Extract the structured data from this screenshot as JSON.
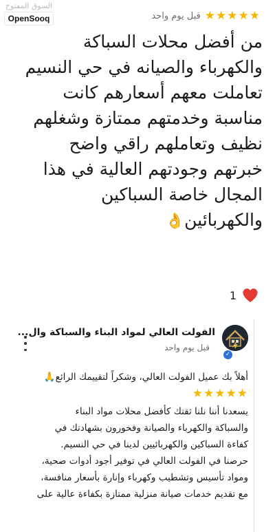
{
  "watermark": {
    "arabic": "السوق المفتوح",
    "brand": "OpenSooq"
  },
  "review": {
    "stars": 5,
    "time": "قبل يوم واحد",
    "lines": [
      "من أفضل محلات السباكة",
      "والكهرباء والصيانه في حي النسيم",
      "تعاملت معهم أسعارهم كانت",
      "مناسبة وخدمتهم ممتازة وشغلهم",
      "نظيف وتعاملهم راقي  واضح",
      "خبرتهم وجودتهم العالية في هذا",
      "المجال خاصة السباكين",
      "والكهربائين"
    ],
    "emoji": "👌",
    "likes": "1"
  },
  "reply": {
    "name": "الفولت العالي لمواد البناء والسباكة وال...",
    "time": "قبل يوم واحد",
    "greeting": "أهلاً بك عميل الفولت العالي، وشكراً لتقييمك الرائع🙏",
    "stars": "★★★★★",
    "lines": [
      "يسعدنا أننا نلنا ثقتك كأفضل محلات مواد البناء",
      "والسباكة والكهرباء والصيانة وفخورون بشهادتك في",
      "كفاءة السباكين والكهربائيين لدينا في حي النسيم.",
      "حرصنا في الفولت العالي في توفير أجود أدوات صحية،",
      "ومواد تأسيس وتشطيب وكهرباء وإنارة بأسعار منافسة،",
      "مع تقديم خدمات صيانة منزلية ممتازة بكفاءة عالية على"
    ]
  },
  "colors": {
    "star": "#f5b800",
    "heart": "#e53935",
    "verified": "#2f6fd6"
  },
  "icons": {
    "heart": "heart-icon",
    "menu": "more-vert-icon",
    "verified": "verified-badge-icon"
  }
}
